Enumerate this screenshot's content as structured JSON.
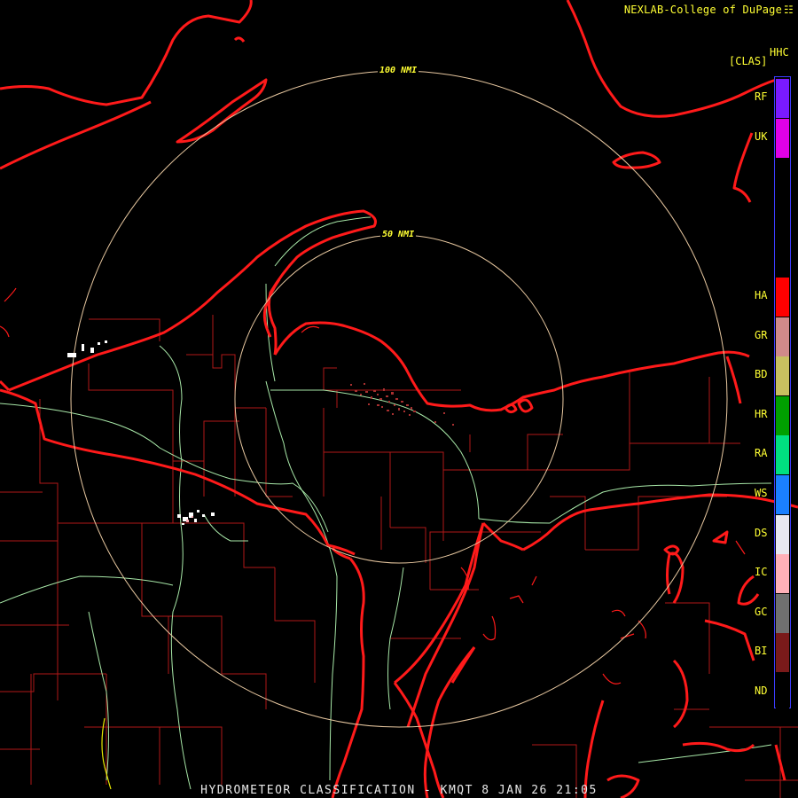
{
  "header": {
    "credit": "NEXLAB-College of DuPage",
    "credit_mark": "☷"
  },
  "footer": {
    "title": "HYDROMETEOR CLASSIFICATION - KMQT 8 JAN 26 21:05"
  },
  "product": {
    "code": "[CLAS]",
    "id": "HHC"
  },
  "range_rings": [
    {
      "label": "100 NMI"
    },
    {
      "label": "50 NMI"
    }
  ],
  "legend": [
    {
      "code": "RF",
      "color": "#7a1aff"
    },
    {
      "code": "UK",
      "color": "#e000e8"
    },
    {
      "code": "HA",
      "color": "#ff0000"
    },
    {
      "code": "GR",
      "color": "#d08a8a"
    },
    {
      "code": "BD",
      "color": "#c8c060"
    },
    {
      "code": "HR",
      "color": "#00a000"
    },
    {
      "code": "RA",
      "color": "#00e080"
    },
    {
      "code": "WS",
      "color": "#1a80ff"
    },
    {
      "code": "DS",
      "color": "#e8e8f0"
    },
    {
      "code": "IC",
      "color": "#ffb0b8"
    },
    {
      "code": "GC",
      "color": "#707070"
    },
    {
      "code": "BI",
      "color": "#7a1a1a"
    },
    {
      "code": "ND",
      "color": "#000000"
    }
  ],
  "colors": {
    "coastline": "#ff1a1a",
    "county_lines": "#b01818",
    "highways": "#a8e8a8",
    "range_rings": "#e8c8a0",
    "echo_near_radar": "#a83030",
    "echo_dry_snow": "#ffffff",
    "highway_yellow": "#e8e800"
  }
}
